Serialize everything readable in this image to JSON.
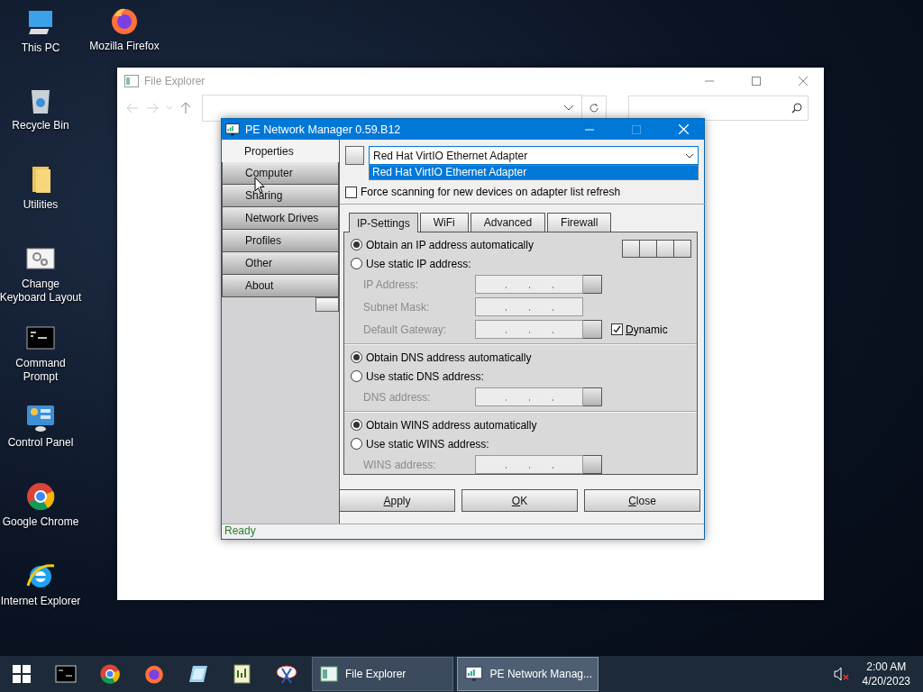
{
  "desktop_icons": [
    {
      "label": "This PC",
      "kind": "pc"
    },
    {
      "label": "Mozilla Firefox",
      "kind": "firefox"
    },
    {
      "label": "Recycle Bin",
      "kind": "recycle"
    },
    {
      "label": "Utilities",
      "kind": "folder"
    },
    {
      "label": "Change Keyboard Layout",
      "kind": "keyboard"
    },
    {
      "label": "Command Prompt",
      "kind": "cmd"
    },
    {
      "label": "Control Panel",
      "kind": "control"
    },
    {
      "label": "Google Chrome",
      "kind": "chrome"
    },
    {
      "label": "Internet Explorer",
      "kind": "ie"
    }
  ],
  "file_explorer": {
    "title": "File Explorer"
  },
  "network_manager": {
    "title": "PE Network Manager 0.59.B12",
    "nav": [
      {
        "label": "Properties",
        "selected": true
      },
      {
        "label": "Computer",
        "selected": false
      },
      {
        "label": "Sharing",
        "selected": false
      },
      {
        "label": "Network Drives",
        "selected": false
      },
      {
        "label": "Profiles",
        "selected": false
      },
      {
        "label": "Other",
        "selected": false
      },
      {
        "label": "About",
        "selected": false
      }
    ],
    "adapter": {
      "value": "Red Hat VirtIO Ethernet Adapter",
      "options": [
        {
          "label": "Red Hat VirtIO Ethernet Adapter",
          "selected": true
        }
      ]
    },
    "force_scan": {
      "label": "Force scanning for new devices on adapter list refresh",
      "checked": false
    },
    "tabs": [
      {
        "label": "IP-Settings",
        "selected": true
      },
      {
        "label": "WiFi",
        "selected": false
      },
      {
        "label": "Advanced",
        "selected": false
      },
      {
        "label": "Firewall",
        "selected": false
      }
    ],
    "sections": [
      {
        "options": [
          {
            "label": "Obtain an IP address automatically",
            "selected": true
          },
          {
            "label": "Use static IP address:",
            "selected": false
          }
        ],
        "fields": [
          {
            "label": "IP Address:",
            "disabled": true,
            "button": true
          },
          {
            "label": "Subnet Mask:",
            "disabled": true,
            "button": false
          },
          {
            "label": "Default Gateway:",
            "disabled": true,
            "button": true,
            "checkbox": {
              "label": "Dynamic",
              "checked": true
            }
          }
        ]
      },
      {
        "options": [
          {
            "label": "Obtain DNS address automatically",
            "selected": true
          },
          {
            "label": "Use static DNS address:",
            "selected": false
          }
        ],
        "fields": [
          {
            "label": "DNS address:",
            "disabled": true,
            "button": true
          }
        ]
      },
      {
        "options": [
          {
            "label": "Obtain WINS address automatically",
            "selected": true
          },
          {
            "label": "Use static WINS address:",
            "selected": false
          }
        ],
        "fields": [
          {
            "label": "WINS address:",
            "disabled": true,
            "button": true
          }
        ]
      }
    ],
    "buttons": [
      {
        "label": "Apply"
      },
      {
        "label": "OK"
      },
      {
        "label": "Close"
      }
    ],
    "status": "Ready"
  },
  "taskbar": {
    "pinned": [
      {
        "kind": "cmd"
      },
      {
        "kind": "chrome"
      },
      {
        "kind": "firefox"
      },
      {
        "kind": "notepad"
      },
      {
        "kind": "editor"
      },
      {
        "kind": "snip"
      }
    ],
    "windows": [
      {
        "label": "File Explorer",
        "kind": "explorer",
        "selected": false
      },
      {
        "label": "PE Network Manag...",
        "kind": "network",
        "selected": true
      }
    ],
    "time": "2:00 AM",
    "date": "4/20/2023"
  }
}
